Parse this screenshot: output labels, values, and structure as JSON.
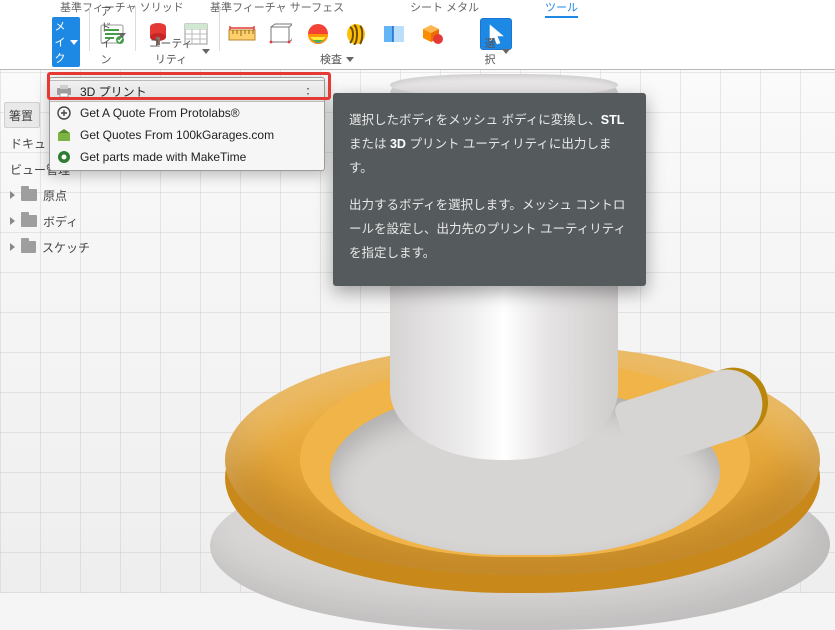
{
  "ribbon": {
    "tabs": {
      "solid": "基準フィーチャ ソリッド",
      "surface": "基準フィーチャ サーフェス",
      "sheet": "シート メタル",
      "tools": "ツール"
    },
    "groups": {
      "make": "メイク",
      "addins": "アドイン",
      "utility": "ユーティリティ",
      "inspect": "検査",
      "select": "選択"
    }
  },
  "menu": {
    "items": [
      "3D プリント",
      "Get A Quote From Protolabs®",
      "Get Quotes From 100kGarages.com",
      "Get parts made with MakeTime"
    ]
  },
  "tooltip": {
    "line1a": "選択したボディをメッシュ ボディに変換し、",
    "stl": "STL",
    "line1b": " または ",
    "threeD": "3D",
    "line1c": " プリント ユーティリティに出力します。",
    "line2": "出力するボディを選択します。メッシュ コントロールを設定し、出力先のプリント ユーティリティを指定します。"
  },
  "browser": {
    "header": "箸置",
    "docset": "ドキュ",
    "views": "ビュー管理",
    "origin": "原点",
    "bodies": "ボディ",
    "sketch": "スケッチ"
  }
}
